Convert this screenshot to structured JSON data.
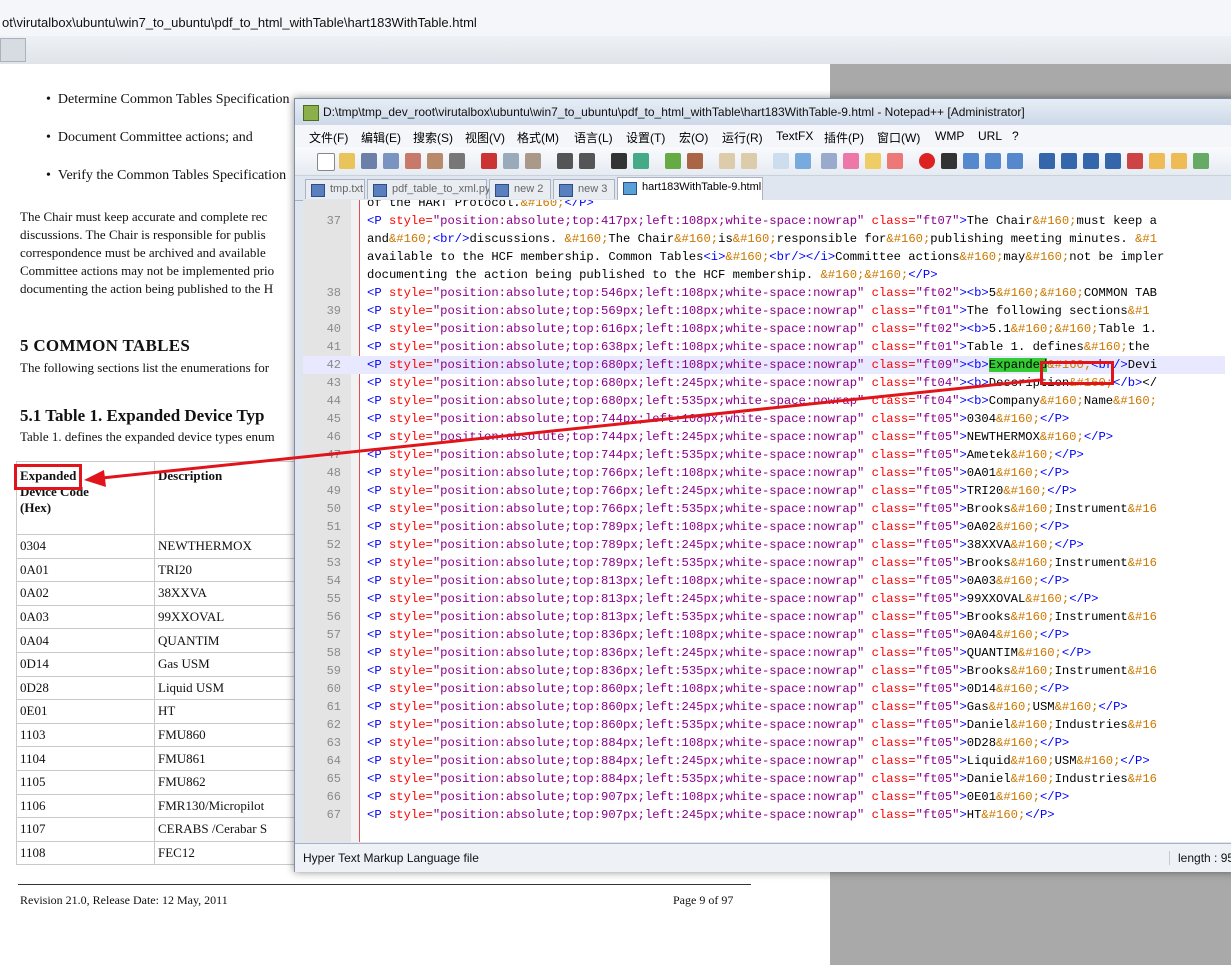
{
  "browser": {
    "address": "ot\\virutalbox\\ubuntu\\win7_to_ubuntu\\pdf_to_html_withTable\\hart183WithTable.html"
  },
  "doc": {
    "bullets": [
      "Determine Common Tables Specification",
      "Document Committee actions; and",
      "Verify the Common Tables Specification"
    ],
    "bullet_mark": "•",
    "paragraph": [
      "The Chair must keep accurate and complete rec",
      "discussions.  The Chair is responsible for publis",
      "correspondence must be archived and available",
      "Committee actions may not be implemented prio",
      "documenting the action being published to the H"
    ],
    "section_title": "5  COMMON TABLES",
    "section_intro": "The following sections list the enumerations for",
    "subsection_title": "5.1  Table 1.  Expanded Device Typ",
    "table_intro": "Table 1. defines the expanded device types enum",
    "table": {
      "header_col1_line1": "Expanded",
      "header_col1_line2": "Device Code",
      "header_col1_line3": "(Hex)",
      "header_col2": "Description",
      "rows": [
        [
          "0304",
          "NEWTHERMOX"
        ],
        [
          "0A01",
          "TRI20"
        ],
        [
          "0A02",
          "38XXVA"
        ],
        [
          "0A03",
          "99XXOVAL"
        ],
        [
          "0A04",
          "QUANTIM"
        ],
        [
          "0D14",
          "Gas USM"
        ],
        [
          "0D28",
          "Liquid USM"
        ],
        [
          "0E01",
          "HT"
        ],
        [
          "1103",
          "FMU860"
        ],
        [
          "1104",
          "FMU861"
        ],
        [
          "1105",
          "FMU862"
        ],
        [
          "1106",
          "FMR130/Micropilot"
        ],
        [
          "1107",
          "CERABS /Cerabar S"
        ],
        [
          "1108",
          "FEC12"
        ]
      ]
    },
    "footer_left": "Revision 21.0, Release Date: 12 May, 2011",
    "footer_right": "Page 9 of 97"
  },
  "npp": {
    "title": "D:\\tmp\\tmp_dev_root\\virutalbox\\ubuntu\\win7_to_ubuntu\\pdf_to_html_withTable\\hart183WithTable-9.html - Notepad++ [Administrator]",
    "menu": [
      "文件(F)",
      "编辑(E)",
      "搜索(S)",
      "视图(V)",
      "格式(M)",
      "语言(L)",
      "设置(T)",
      "宏(O)",
      "运行(R)",
      "TextFX",
      "插件(P)",
      "窗口(W)",
      "WMP",
      "URL",
      "?"
    ],
    "tabs": [
      "tmp.txt",
      "pdf_table_to_xml.py",
      "new  2",
      "new  3",
      "hart183WithTable-9.html"
    ],
    "status_left": "Hyper Text Markup Language file",
    "status_right": "length : 95",
    "lines": [
      {
        "n": "",
        "src": "of the HART Protocol.&#160;</P>"
      },
      {
        "n": "37",
        "src": "<P style=\"position:absolute;top:417px;left:108px;white-space:nowrap\" class=\"ft07\">The Chair&#160;must keep a"
      },
      {
        "n": "",
        "src": "and&#160;<br/>discussions. &#160;The Chair&#160;is&#160;responsible for&#160;publishing meeting minutes. &#1"
      },
      {
        "n": "",
        "src": "available to the HCF membership. Common Tables<i>&#160;<br/></i>Committee actions&#160;may&#160;not be impler"
      },
      {
        "n": "",
        "src": "documenting the action being published to the HCF membership. &#160;&#160;</P>"
      },
      {
        "n": "38",
        "src": "<P style=\"position:absolute;top:546px;left:108px;white-space:nowrap\" class=\"ft02\"><b>5&#160;&#160;COMMON TAB"
      },
      {
        "n": "39",
        "src": "<P style=\"position:absolute;top:569px;left:108px;white-space:nowrap\" class=\"ft01\">The following sections&#1"
      },
      {
        "n": "40",
        "src": "<P style=\"position:absolute;top:616px;left:108px;white-space:nowrap\" class=\"ft02\"><b>5.1&#160;&#160;Table 1."
      },
      {
        "n": "41",
        "src": "<P style=\"position:absolute;top:638px;left:108px;white-space:nowrap\" class=\"ft01\">Table 1. defines&#160;the"
      },
      {
        "n": "42",
        "src": "<P style=\"position:absolute;top:680px;left:108px;white-space:nowrap\" class=\"ft09\"><b>",
        "hl": "Expanded",
        "rest": "&#160;<br/>Devi"
      },
      {
        "n": "43",
        "src": "<P style=\"position:absolute;top:680px;left:245px;white-space:nowrap\" class=\"ft04\"><b>Description&#160;</b></"
      },
      {
        "n": "44",
        "src": "<P style=\"position:absolute;top:680px;left:535px;white-space:nowrap\" class=\"ft04\"><b>Company&#160;Name&#160;"
      },
      {
        "n": "45",
        "src": "<P style=\"position:absolute;top:744px;left:108px;white-space:nowrap\" class=\"ft05\">0304&#160;</P>"
      },
      {
        "n": "46",
        "src": "<P style=\"position:absolute;top:744px;left:245px;white-space:nowrap\" class=\"ft05\">NEWTHERMOX&#160;</P>"
      },
      {
        "n": "47",
        "src": "<P style=\"position:absolute;top:744px;left:535px;white-space:nowrap\" class=\"ft05\">Ametek&#160;</P>"
      },
      {
        "n": "48",
        "src": "<P style=\"position:absolute;top:766px;left:108px;white-space:nowrap\" class=\"ft05\">0A01&#160;</P>"
      },
      {
        "n": "49",
        "src": "<P style=\"position:absolute;top:766px;left:245px;white-space:nowrap\" class=\"ft05\">TRI20&#160;</P>"
      },
      {
        "n": "50",
        "src": "<P style=\"position:absolute;top:766px;left:535px;white-space:nowrap\" class=\"ft05\">Brooks&#160;Instrument&#16"
      },
      {
        "n": "51",
        "src": "<P style=\"position:absolute;top:789px;left:108px;white-space:nowrap\" class=\"ft05\">0A02&#160;</P>"
      },
      {
        "n": "52",
        "src": "<P style=\"position:absolute;top:789px;left:245px;white-space:nowrap\" class=\"ft05\">38XXVA&#160;</P>"
      },
      {
        "n": "53",
        "src": "<P style=\"position:absolute;top:789px;left:535px;white-space:nowrap\" class=\"ft05\">Brooks&#160;Instrument&#16"
      },
      {
        "n": "54",
        "src": "<P style=\"position:absolute;top:813px;left:108px;white-space:nowrap\" class=\"ft05\">0A03&#160;</P>"
      },
      {
        "n": "55",
        "src": "<P style=\"position:absolute;top:813px;left:245px;white-space:nowrap\" class=\"ft05\">99XXOVAL&#160;</P>"
      },
      {
        "n": "56",
        "src": "<P style=\"position:absolute;top:813px;left:535px;white-space:nowrap\" class=\"ft05\">Brooks&#160;Instrument&#16"
      },
      {
        "n": "57",
        "src": "<P style=\"position:absolute;top:836px;left:108px;white-space:nowrap\" class=\"ft05\">0A04&#160;</P>"
      },
      {
        "n": "58",
        "src": "<P style=\"position:absolute;top:836px;left:245px;white-space:nowrap\" class=\"ft05\">QUANTIM&#160;</P>"
      },
      {
        "n": "59",
        "src": "<P style=\"position:absolute;top:836px;left:535px;white-space:nowrap\" class=\"ft05\">Brooks&#160;Instrument&#16"
      },
      {
        "n": "60",
        "src": "<P style=\"position:absolute;top:860px;left:108px;white-space:nowrap\" class=\"ft05\">0D14&#160;</P>"
      },
      {
        "n": "61",
        "src": "<P style=\"position:absolute;top:860px;left:245px;white-space:nowrap\" class=\"ft05\">Gas&#160;USM&#160;</P>"
      },
      {
        "n": "62",
        "src": "<P style=\"position:absolute;top:860px;left:535px;white-space:nowrap\" class=\"ft05\">Daniel&#160;Industries&#16"
      },
      {
        "n": "63",
        "src": "<P style=\"position:absolute;top:884px;left:108px;white-space:nowrap\" class=\"ft05\">0D28&#160;</P>"
      },
      {
        "n": "64",
        "src": "<P style=\"position:absolute;top:884px;left:245px;white-space:nowrap\" class=\"ft05\">Liquid&#160;USM&#160;</P>"
      },
      {
        "n": "65",
        "src": "<P style=\"position:absolute;top:884px;left:535px;white-space:nowrap\" class=\"ft05\">Daniel&#160;Industries&#16"
      },
      {
        "n": "66",
        "src": "<P style=\"position:absolute;top:907px;left:108px;white-space:nowrap\" class=\"ft05\">0E01&#160;</P>"
      },
      {
        "n": "67",
        "src": "<P style=\"position:absolute;top:907px;left:245px;white-space:nowrap\" class=\"ft05\">HT&#160;</P>"
      }
    ]
  }
}
